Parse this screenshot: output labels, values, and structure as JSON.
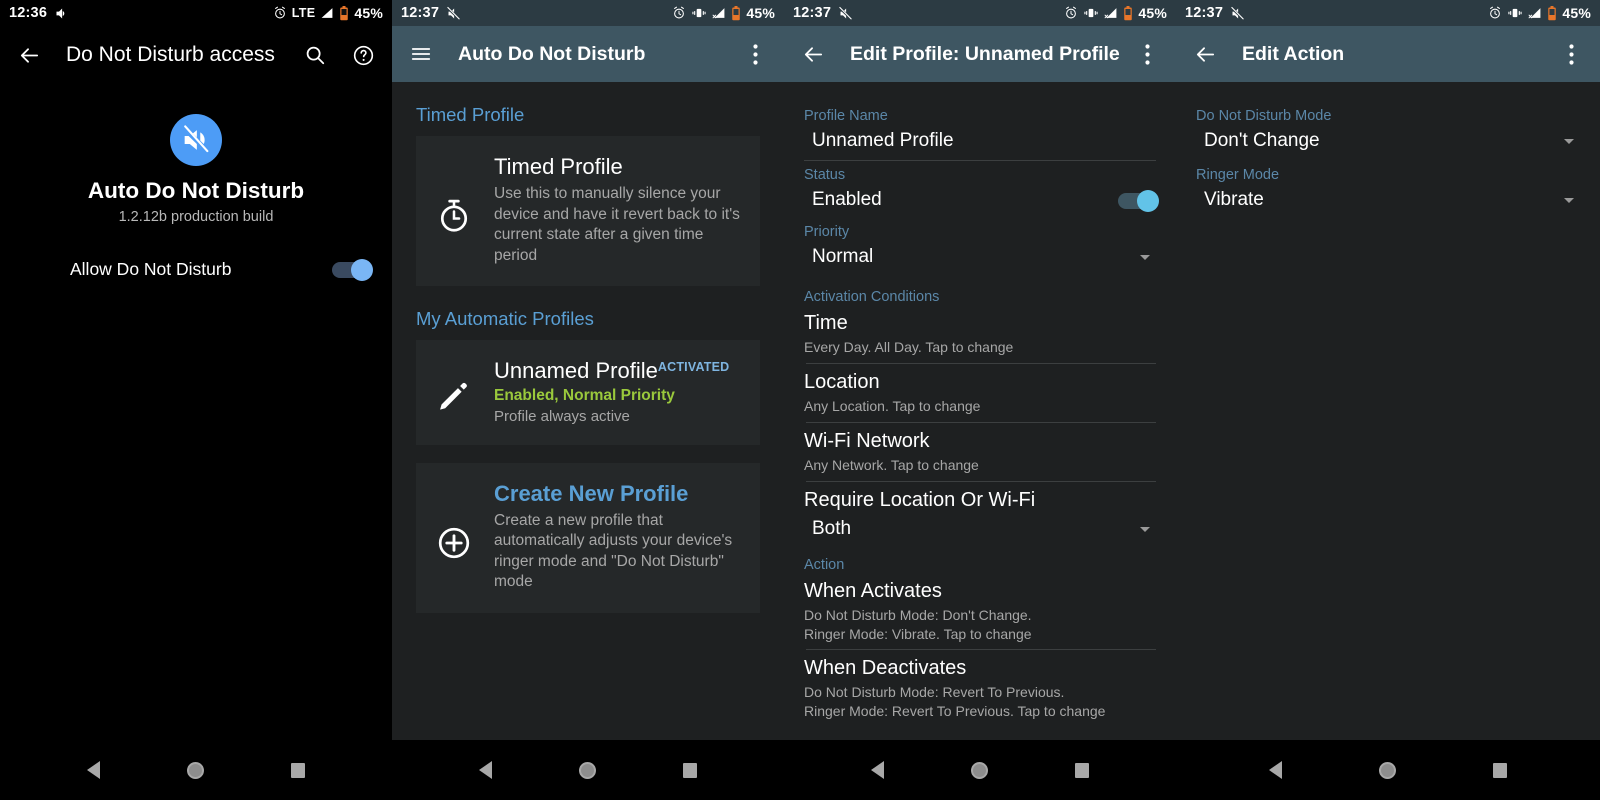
{
  "panels": [
    {
      "id": "dnd-access",
      "statusbar": {
        "time": "12:36",
        "left_icons": [
          "volume-icon"
        ],
        "network_label": "LTE",
        "right_icons": [
          "alarm-icon",
          "signal-icon",
          "battery-icon"
        ],
        "battery": "45%"
      },
      "toolbar": {
        "title": "Do Not Disturb access",
        "back_icon": "back-arrow-icon",
        "actions": [
          "search-icon",
          "help-icon"
        ]
      },
      "app": {
        "icon": "mute-speaker-icon",
        "name": "Auto Do Not Disturb",
        "version": "1.2.12b production build"
      },
      "allow_row": {
        "label": "Allow Do Not Disturb",
        "toggle_on": true
      }
    },
    {
      "id": "auto-dnd-main",
      "statusbar": {
        "time": "12:37",
        "left_icons": [
          "mute-speaker-icon"
        ],
        "right_icons": [
          "alarm-icon",
          "vibrate-icon",
          "signal-off-icon",
          "battery-icon"
        ],
        "battery": "45%"
      },
      "toolbar": {
        "title": "Auto Do Not Disturb",
        "menu_icon": "hamburger-menu-icon",
        "actions": [
          "overflow-menu-icon"
        ]
      },
      "sections": [
        {
          "header": "Timed Profile",
          "card": {
            "icon": "stopwatch-icon",
            "title": "Timed Profile",
            "subtitle": "Use this to manually silence your device and have it revert back to it's current state after a given time period"
          }
        },
        {
          "header": "My Automatic Profiles",
          "card": {
            "icon": "pencil-icon",
            "title": "Unnamed Profile",
            "badge": "ACTIVATED",
            "status_line": "Enabled, Normal Priority",
            "subtitle": "Profile always active"
          }
        }
      ],
      "create_card": {
        "icon": "plus-circle-icon",
        "title": "Create New Profile",
        "subtitle": "Create a new profile that automatically adjusts your device's ringer mode and \"Do Not Disturb\" mode"
      }
    },
    {
      "id": "edit-profile",
      "statusbar": {
        "time": "12:37",
        "left_icons": [
          "mute-speaker-icon"
        ],
        "right_icons": [
          "alarm-icon",
          "vibrate-icon",
          "signal-off-icon",
          "battery-icon"
        ],
        "battery": "45%"
      },
      "toolbar": {
        "title": "Edit Profile: Unnamed Profile",
        "back_icon": "back-arrow-icon",
        "actions": [
          "overflow-menu-icon"
        ]
      },
      "fields": {
        "profile_name_label": "Profile Name",
        "profile_name_value": "Unnamed Profile",
        "status_label": "Status",
        "status_value": "Enabled",
        "status_toggle_on": true,
        "priority_label": "Priority",
        "priority_value": "Normal",
        "activation_label": "Activation Conditions",
        "conditions": [
          {
            "title": "Time",
            "sub": "Every Day. All Day. Tap to change"
          },
          {
            "title": "Location",
            "sub": "Any Location. Tap to change"
          },
          {
            "title": "Wi-Fi Network",
            "sub": "Any Network. Tap to change"
          }
        ],
        "require_label": "Require Location Or Wi-Fi",
        "require_value": "Both",
        "action_label": "Action",
        "actions": [
          {
            "title": "When Activates",
            "sub": "Do Not Disturb Mode: Don't Change.\nRinger Mode: Vibrate. Tap to change"
          },
          {
            "title": "When Deactivates",
            "sub": "Do Not Disturb Mode: Revert To Previous.\nRinger Mode: Revert To Previous. Tap to change"
          }
        ]
      }
    },
    {
      "id": "edit-action",
      "statusbar": {
        "time": "12:37",
        "left_icons": [
          "mute-speaker-icon"
        ],
        "right_icons": [
          "alarm-icon",
          "vibrate-icon",
          "signal-off-icon",
          "battery-icon"
        ],
        "battery": "45%"
      },
      "toolbar": {
        "title": "Edit Action",
        "back_icon": "back-arrow-icon",
        "actions": [
          "overflow-menu-icon"
        ]
      },
      "fields": {
        "dnd_label": "Do Not Disturb Mode",
        "dnd_value": "Don't Change",
        "ringer_label": "Ringer Mode",
        "ringer_value": "Vibrate"
      }
    }
  ],
  "navbar": {
    "back": "back-nav-icon",
    "home": "home-nav-icon",
    "recents": "recents-nav-icon"
  },
  "colors": {
    "toolbar": "#3e5662",
    "accent_blue": "#5a9fd4",
    "label_blue": "#5b87a8",
    "status_green": "#9ac93c",
    "toggle_blue": "#7ab6f5",
    "background": "#1e2021",
    "card": "#252829"
  }
}
